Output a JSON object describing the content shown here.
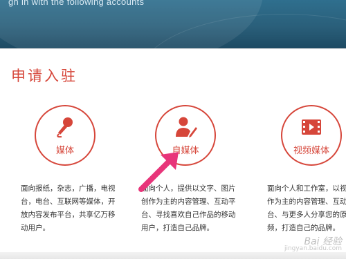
{
  "banner": {
    "text": "gn in with the following accounts"
  },
  "section_title": "申请入驻",
  "options": [
    {
      "label": "媒体",
      "icon": "microphone-icon",
      "desc": [
        "面向报纸，杂志，广播，电视",
        "台，电台、互联网等媒体，开",
        "放内容发布平台，共享亿万移",
        "动用户。"
      ]
    },
    {
      "label": "自媒体",
      "icon": "person-edit-icon",
      "desc": [
        "面向个人，提供以文字、图片",
        "创作为主的内容管理、互动平",
        "台、寻找喜欢自己作品的移动",
        "用户，打造自己品牌。"
      ]
    },
    {
      "label": "视频媒体",
      "icon": "film-play-icon",
      "desc": [
        "面向个人和工作室，以视",
        "作为主的内容管理、互动",
        "台、与更多人分享您的原",
        "频，打造自己的品牌。"
      ]
    }
  ],
  "colors": {
    "accent": "#d6463a",
    "banner": "#2a5f7a",
    "arrow": "#e8357a"
  },
  "watermark": {
    "brand": "Bai 经验",
    "url": "jingyan.baidu.com"
  }
}
